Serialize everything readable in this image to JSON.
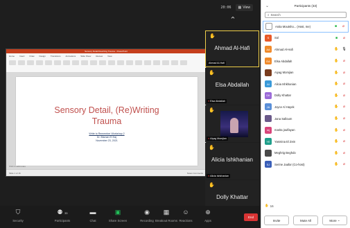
{
  "topbar": {
    "time": "20:06",
    "view_label": "View"
  },
  "presentation": {
    "window_title": "Sensory Detail Rewriting Trauma - PowerPoint",
    "ribbon_tabs": [
      "Home",
      "Insert",
      "Draw",
      "Design",
      "Transitions",
      "Animations",
      "Slide Show",
      "Review",
      "View"
    ],
    "slide_title_line1": "Sensory Detail, (Re)Writing",
    "slide_title_line2": "Trauma",
    "slide_sub1": "Write to Remember Workshop 2",
    "slide_sub2": "Dr. Bisman El Haj",
    "slide_sub3": "November 23, 2021",
    "notes_hint": "Click to add notes",
    "status_left": "Slide 1 of 16",
    "status_right": "Notes   Comments"
  },
  "video_strip": {
    "tiles": [
      {
        "name": "Ahmad Al-Hafi",
        "label": "Ahmad Al-Hafi"
      },
      {
        "name": "Elsa Abdallah",
        "label": "Elsa Abdallah"
      },
      {
        "name": "",
        "label": "Aiyag Momjian"
      },
      {
        "name": "Alicia Ishkhanian",
        "label": "Alicia Ishkhanian"
      },
      {
        "name": "Dolly Khattar",
        "label": "Dolly Khattar"
      }
    ]
  },
  "participants": {
    "title": "Participants (33)",
    "search_placeholder": "Search",
    "list": [
      {
        "initials": "",
        "name": "Anita Moutsho... (Host, me)",
        "color": "#ffffff",
        "icons": [
          "cam-g",
          "mic-red"
        ]
      },
      {
        "initials": "S",
        "name": "Sol",
        "color": "#e85a2a",
        "icons": [
          "cam-g",
          "mic-red"
        ]
      },
      {
        "initials": "AA",
        "name": "Ahmad Al-Hafi",
        "color": "#f08a2b",
        "icons": [
          "hand",
          "mic"
        ]
      },
      {
        "initials": "EA",
        "name": "Elsa Abdallah",
        "color": "#f08a2b",
        "icons": [
          "hand",
          "mic-red"
        ]
      },
      {
        "initials": "",
        "name": "Aiyag Momjian",
        "color": "#7a3d1e",
        "icons": [
          "hand",
          "mic-red"
        ]
      },
      {
        "initials": "AI",
        "name": "Alicia Ishkhanian",
        "color": "#3a9ad9",
        "icons": [
          "hand",
          "mic-red"
        ]
      },
      {
        "initials": "DK",
        "name": "Dolly Khattar",
        "color": "#9b6ad8",
        "icons": [
          "hand",
          "mic-red"
        ]
      },
      {
        "initials": "JA",
        "name": "Joyce Al Hayek",
        "color": "#5a8fd8",
        "icons": [
          "hand",
          "mic-red"
        ]
      },
      {
        "initials": "",
        "name": "Jana Salloum",
        "color": "#6b5a8a",
        "icons": [
          "hand",
          "mic-red"
        ]
      },
      {
        "initials": "mj",
        "name": "marita joulfayan",
        "color": "#d8457a",
        "icons": [
          "hand",
          "mic-red"
        ]
      },
      {
        "initials": "YE",
        "name": "Yasmina El Zein",
        "color": "#1e9e8a",
        "icons": [
          "hand",
          "mic-red"
        ]
      },
      {
        "initials": "",
        "name": "Meghrig Beghdo",
        "color": "#4a4a4a",
        "icons": [
          "hand",
          "mic-red"
        ]
      },
      {
        "initials": "SJ",
        "name": "Serine Jaafar (Co-host)",
        "color": "#3a5fb8",
        "icons": [
          "hand",
          "mic-red"
        ]
      }
    ],
    "raised_count": "16",
    "invite_label": "Invite",
    "mute_all_label": "Mute All",
    "more_label": "More"
  },
  "toolbar": {
    "security_label": "Security",
    "participants_label": "Participants",
    "participants_count": "33",
    "chat_label": "Chat",
    "share_label": "Share Screen",
    "record_label": "Recording",
    "breakout_label": "Breakout Rooms",
    "reactions_label": "Reactions",
    "apps_label": "Apps",
    "end_label": "End"
  }
}
